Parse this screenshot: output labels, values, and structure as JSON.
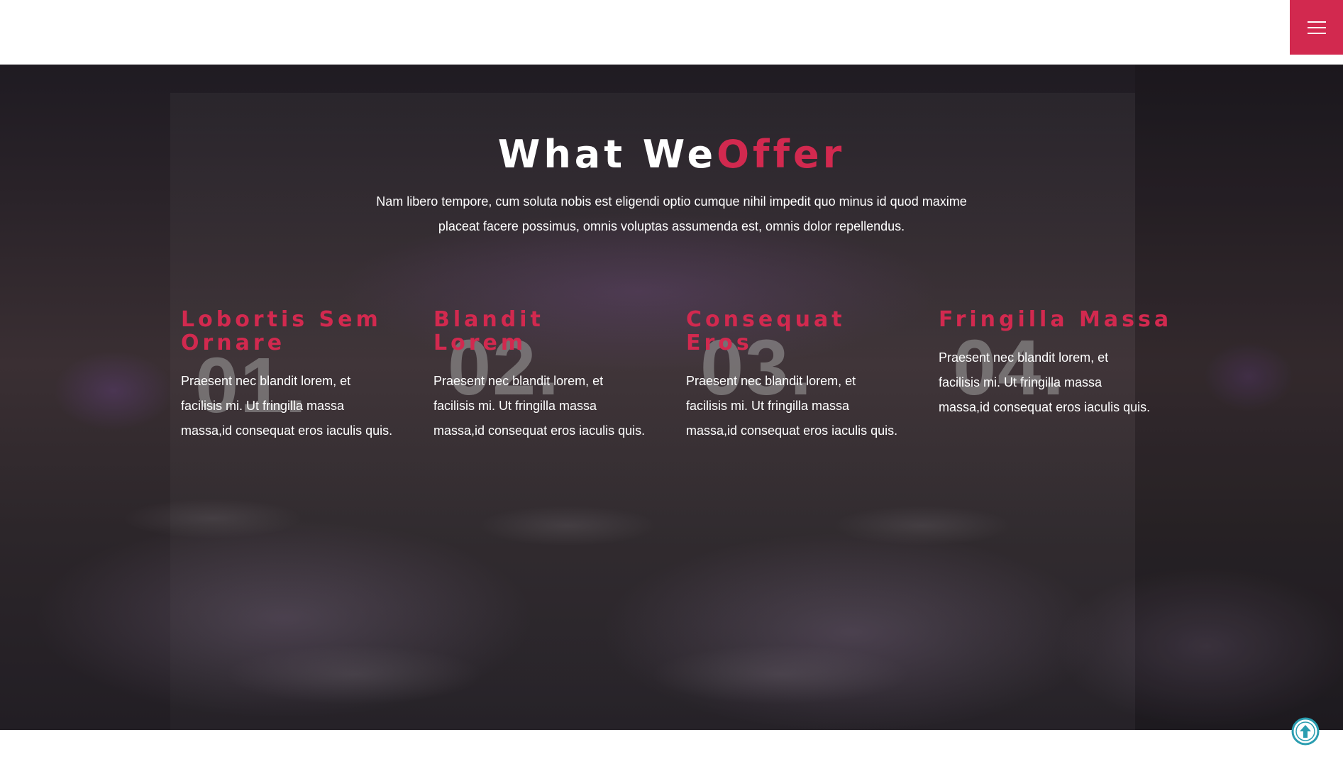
{
  "header": {
    "menu_icon": "hamburger-menu-icon",
    "accent_color": "#d2294f"
  },
  "section": {
    "title_main": "What We",
    "title_accent": "Offer",
    "intro": "Nam libero tempore, cum soluta nobis est eligendi optio cumque nihil impedit quo minus id quod maxime placeat facere possimus, omnis voluptas assumenda est, omnis dolor repellendus."
  },
  "offers": [
    {
      "number": "01.",
      "title": "Lobortis Sem Ornare",
      "text": "Praesent nec blandit lorem, et facilisis mi. Ut fringilla massa massa,id consequat eros iaculis quis."
    },
    {
      "number": "02.",
      "title": "Blandit Lorem",
      "text": "Praesent nec blandit lorem, et facilisis mi. Ut fringilla massa massa,id consequat eros iaculis quis."
    },
    {
      "number": "03.",
      "title": "Consequat Eros",
      "text": "Praesent nec blandit lorem, et facilisis mi. Ut fringilla massa massa,id consequat eros iaculis quis."
    },
    {
      "number": "04.",
      "title": "Fringilla Massa",
      "text": "Praesent nec blandit lorem, et facilisis mi. Ut fringilla massa massa,id consequat eros iaculis quis."
    }
  ],
  "back_to_top": {
    "icon": "arrow-up-circle-icon",
    "color": "#2a9db0"
  }
}
